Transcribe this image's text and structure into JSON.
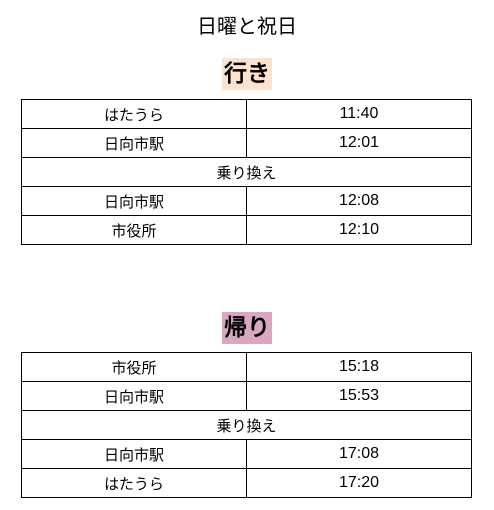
{
  "title": "日曜と祝日",
  "outbound": {
    "heading": "行き",
    "rows": [
      {
        "stop": "はたうら",
        "time": "11:40"
      },
      {
        "stop": "日向市駅",
        "time": "12:01"
      },
      {
        "transfer": "乗り換え"
      },
      {
        "stop": "日向市駅",
        "time": "12:08"
      },
      {
        "stop": "市役所",
        "time": "12:10"
      }
    ]
  },
  "return": {
    "heading": "帰り",
    "rows": [
      {
        "stop": "市役所",
        "time": "15:18"
      },
      {
        "stop": "日向市駅",
        "time": "15:53"
      },
      {
        "transfer": "乗り換え"
      },
      {
        "stop": "日向市駅",
        "time": "17:08"
      },
      {
        "stop": "はたうら",
        "time": "17:20"
      }
    ]
  },
  "colors": {
    "outbound_highlight": "#fbe3cf",
    "return_highlight": "#d9a6c4"
  }
}
